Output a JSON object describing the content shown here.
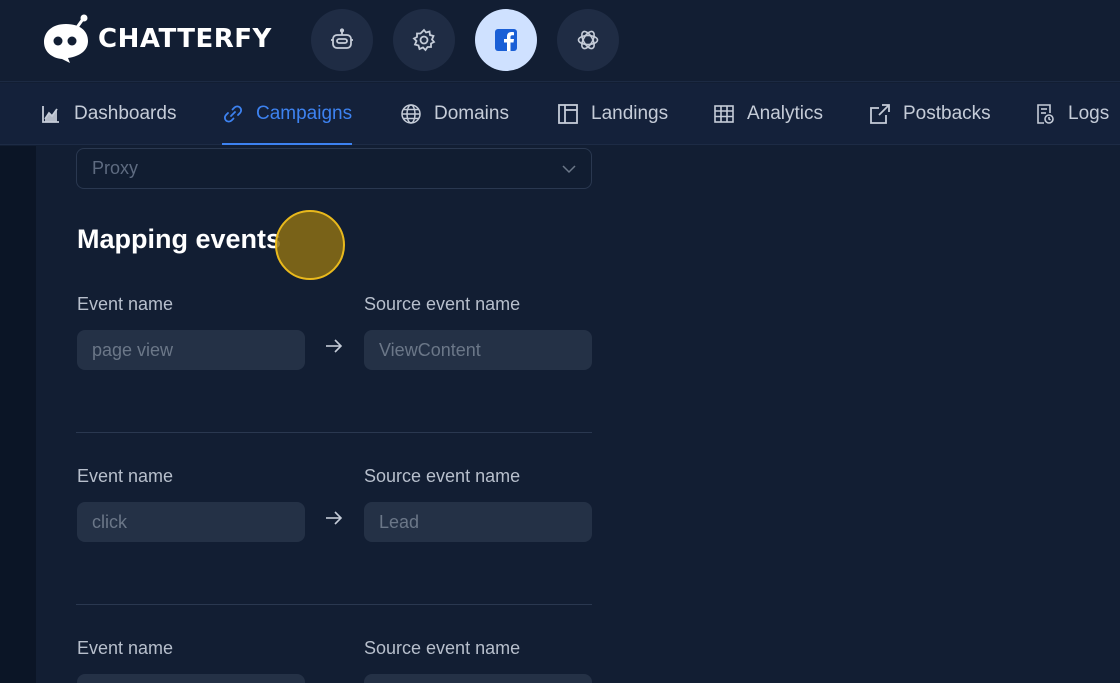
{
  "brand": {
    "name": "CHATTERFY"
  },
  "top_buttons": [
    {
      "icon": "robot-icon",
      "active": false
    },
    {
      "icon": "gear-icon",
      "active": false
    },
    {
      "icon": "facebook-icon",
      "active": true
    },
    {
      "icon": "openai-icon",
      "active": false
    }
  ],
  "nav": {
    "items": [
      {
        "label": "Dashboards",
        "icon": "chart-icon",
        "active": false
      },
      {
        "label": "Campaigns",
        "icon": "link-icon",
        "active": true
      },
      {
        "label": "Domains",
        "icon": "globe-icon",
        "active": false
      },
      {
        "label": "Landings",
        "icon": "layout-icon",
        "active": false
      },
      {
        "label": "Analytics",
        "icon": "table-icon",
        "active": false
      },
      {
        "label": "Postbacks",
        "icon": "external-link-icon",
        "active": false
      },
      {
        "label": "Logs",
        "icon": "log-icon",
        "active": false
      }
    ]
  },
  "proxy_select": {
    "value": "Proxy"
  },
  "mapping": {
    "title": "Mapping events",
    "event_name_label": "Event name",
    "source_event_name_label": "Source event name",
    "rows": [
      {
        "event_name": "page view",
        "source_event_name": "ViewContent"
      },
      {
        "event_name": "click",
        "source_event_name": "Lead"
      },
      {
        "event_name": "",
        "source_event_name": ""
      }
    ]
  },
  "colors": {
    "background": "#121e33",
    "accent": "#3d82f0",
    "input_bg": "#243146",
    "active_button": "#cfe1ff"
  }
}
